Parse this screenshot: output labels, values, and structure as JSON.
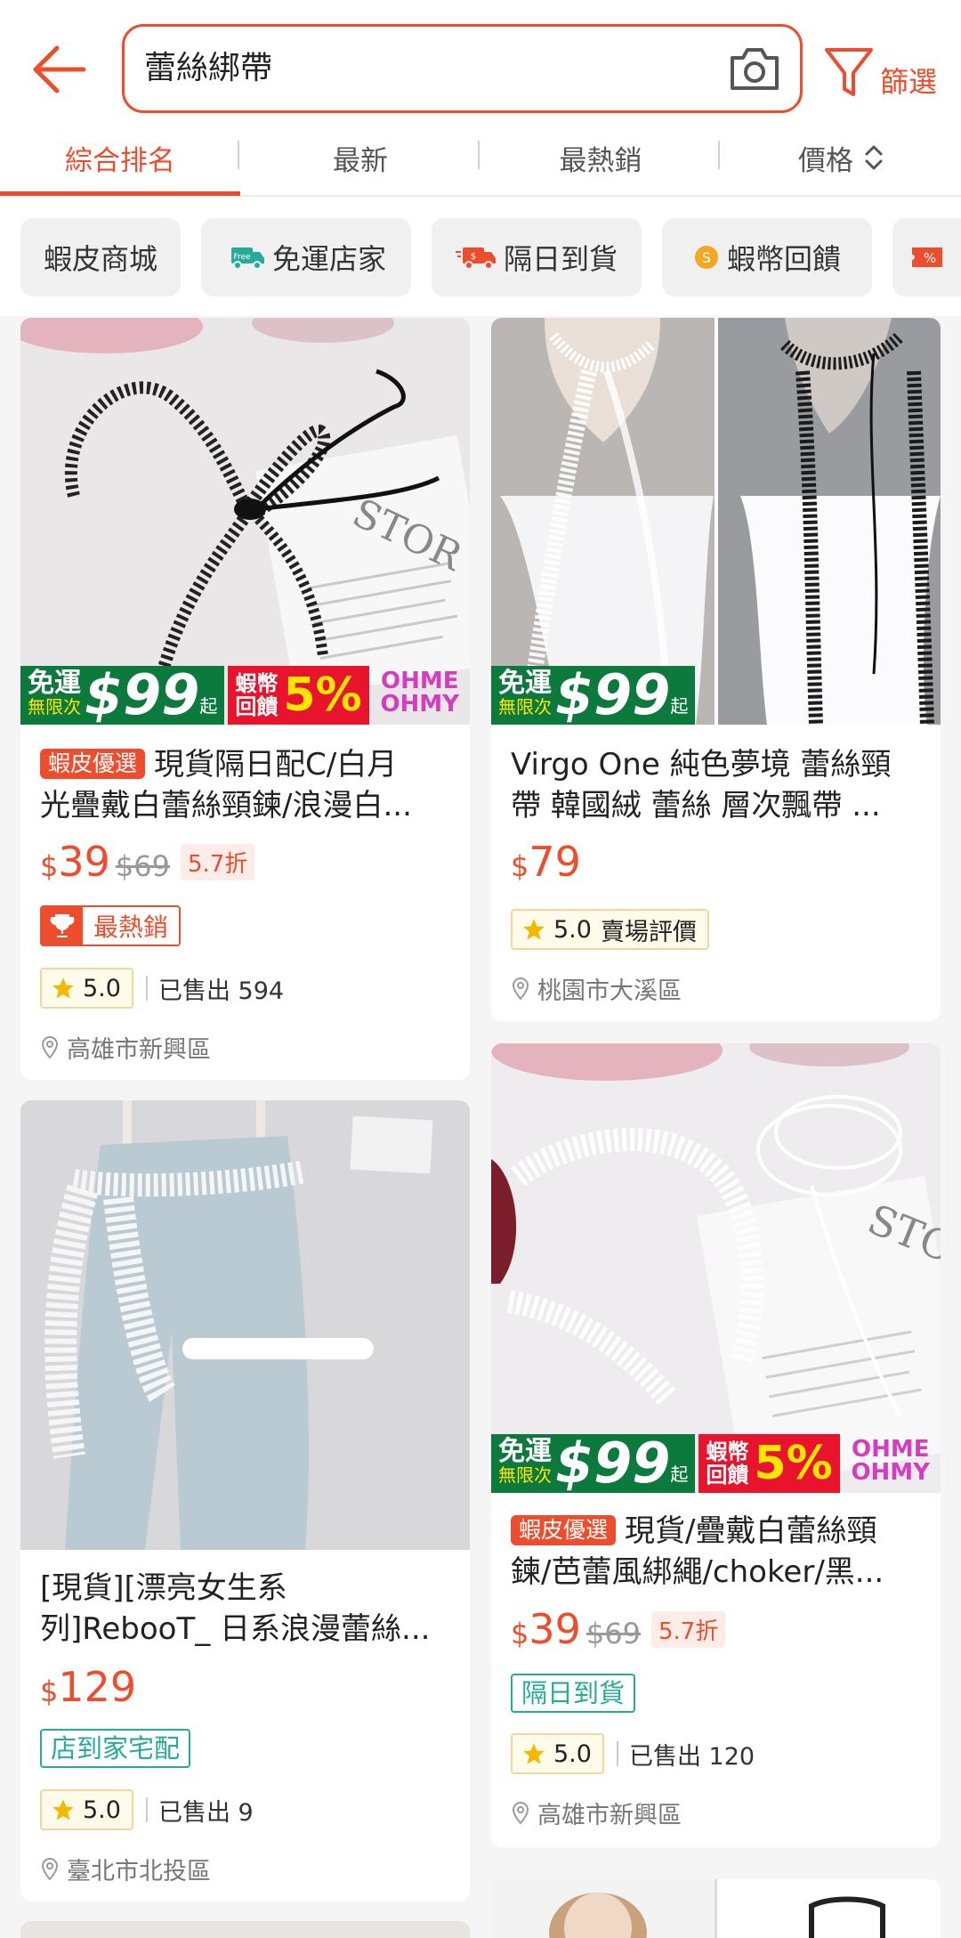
{
  "header": {
    "search_value": "蕾絲綁帶",
    "filter_label": "篩選"
  },
  "sort_tabs": [
    {
      "label": "綜合排名",
      "active": true
    },
    {
      "label": "最新",
      "active": false
    },
    {
      "label": "最熱銷",
      "active": false
    },
    {
      "label": "價格",
      "active": false
    }
  ],
  "chips": [
    {
      "label": "蝦皮商城"
    },
    {
      "label": "免運店家",
      "icon": "free-shipping-truck-icon"
    },
    {
      "label": "隔日到貨",
      "icon": "fast-delivery-truck-icon"
    },
    {
      "label": "蝦幣回饋",
      "icon": "coin-icon"
    }
  ],
  "promo": {
    "free_shipping_line1": "免運",
    "free_shipping_line2": "無限次",
    "free_shipping_amount": "$99",
    "free_shipping_suffix": "起",
    "coin_line1": "蝦幣",
    "coin_line2": "回饋",
    "coin_pct": "5%",
    "brand_logo_line1": "OHME",
    "brand_logo_line2": "OHMY"
  },
  "products": [
    {
      "badge": "蝦皮優選",
      "title_line1": "現貨隔日配C/白月",
      "title_line2": "光疊戴白蕾絲頸鍊/浪漫白...",
      "currency": "$",
      "price": "39",
      "original_price": "$69",
      "discount": "5.7折",
      "hot_label": "最熱銷",
      "rating": "5.0",
      "sold": "已售出 594",
      "location": "高雄市新興區"
    },
    {
      "title_line1": "Virgo One 純色夢境 蕾絲頸",
      "title_line2": "帶 韓國絨 蕾絲 層次飄帶 ...",
      "currency": "$",
      "price": "79",
      "rating": "5.0",
      "rating_extra": "賣場評價",
      "location": "桃園市大溪區"
    },
    {
      "title_line1": "[現貨][漂亮女生系",
      "title_line2": "列]RebooT_ 日系浪漫蕾絲...",
      "currency": "$",
      "price": "129",
      "tag": "店到家宅配",
      "rating": "5.0",
      "sold": "已售出 9",
      "location": "臺北市北投區"
    },
    {
      "badge": "蝦皮優選",
      "title_line1": "現貨/疊戴白蕾絲頸",
      "title_line2": "鍊/芭蕾風綁繩/choker/黑...",
      "currency": "$",
      "price": "39",
      "original_price": "$69",
      "discount": "5.7折",
      "tag": "隔日到貨",
      "rating": "5.0",
      "sold": "已售出 120",
      "location": "高雄市新興區"
    }
  ],
  "colors": {
    "brand_orange": "#ee4d2d",
    "teal": "#26aa99",
    "star_yellow": "#f5b800"
  }
}
